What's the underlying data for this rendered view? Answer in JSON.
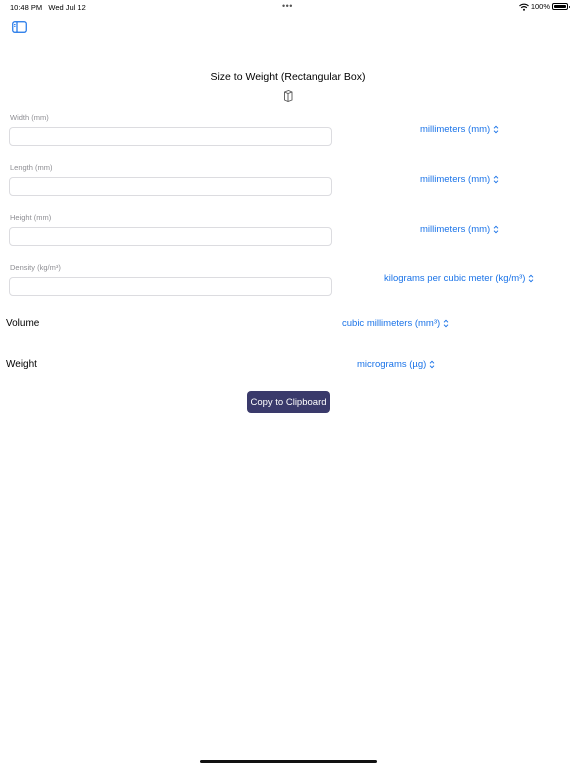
{
  "status_bar": {
    "time": "10:48 PM",
    "date": "Wed Jul 12",
    "dots": "•••",
    "battery_percent": "100%",
    "battery_level": 1.0
  },
  "header": {
    "title": "Size to Weight (Rectangular Box)",
    "sidebar_icon": "sidebar-left-icon",
    "title_icon": "box-3d-icon"
  },
  "fields": [
    {
      "label": "Width (mm)",
      "value": "",
      "placeholder": "",
      "unit": "millimeters (mm)"
    },
    {
      "label": "Length (mm)",
      "value": "",
      "placeholder": "",
      "unit": "millimeters (mm)"
    },
    {
      "label": "Height (mm)",
      "value": "",
      "placeholder": "",
      "unit": "millimeters (mm)"
    },
    {
      "label": "Density (kg/m³)",
      "value": "",
      "placeholder": "",
      "unit": "kilograms per cubic meter (kg/m³)"
    }
  ],
  "results": {
    "volume": {
      "label": "Volume",
      "unit": "cubic millimeters (mm³)"
    },
    "weight": {
      "label": "Weight",
      "unit": "micrograms (µg)"
    }
  },
  "actions": {
    "copy_label": "Copy to Clipboard"
  },
  "colors": {
    "accent": "#1a73e8",
    "button_bg": "#3a3a6b",
    "label_gray": "#8e8e93"
  }
}
